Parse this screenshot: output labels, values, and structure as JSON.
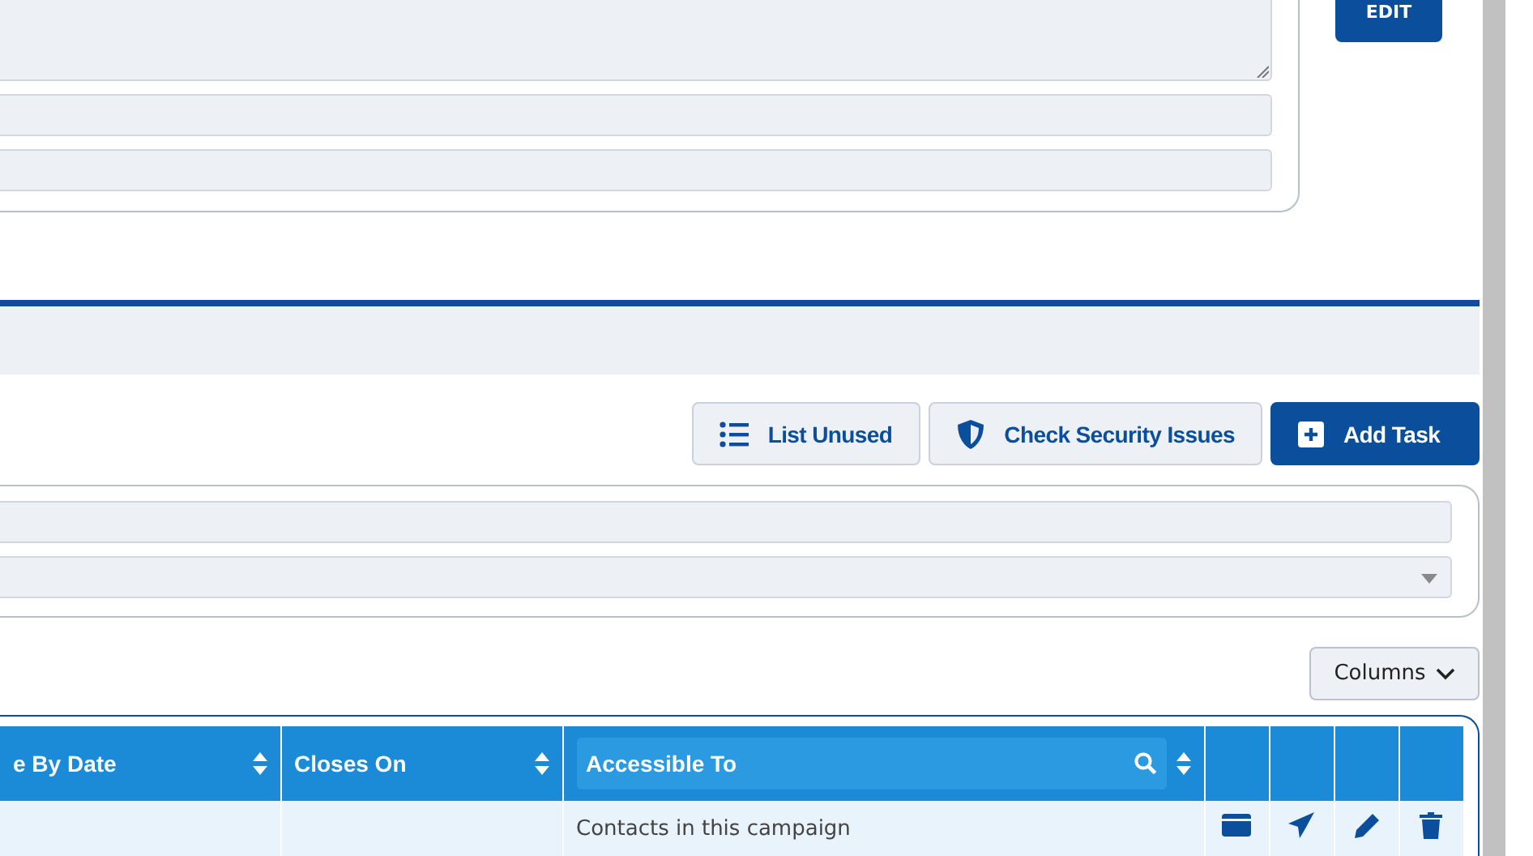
{
  "top_panel": {
    "edit_button": "EDIT"
  },
  "toolbar": {
    "buttons": [
      {
        "kind": "list",
        "label": "List Unused"
      },
      {
        "kind": "shield",
        "label": "Check Security Issues"
      },
      {
        "kind": "add",
        "label": "Add Task"
      }
    ]
  },
  "columns_button": "Columns",
  "table": {
    "columns": [
      {
        "label": "e By Date",
        "search": false
      },
      {
        "label": "Closes On",
        "search": false
      },
      {
        "label": "Accessible To",
        "search": true
      }
    ],
    "action_columns": [
      {
        "kind": "card"
      },
      {
        "kind": "send"
      },
      {
        "kind": "edit"
      },
      {
        "kind": "delete"
      }
    ],
    "rows": [
      {
        "cells": [
          "",
          "",
          "Contacts in this campaign"
        ]
      }
    ]
  }
}
